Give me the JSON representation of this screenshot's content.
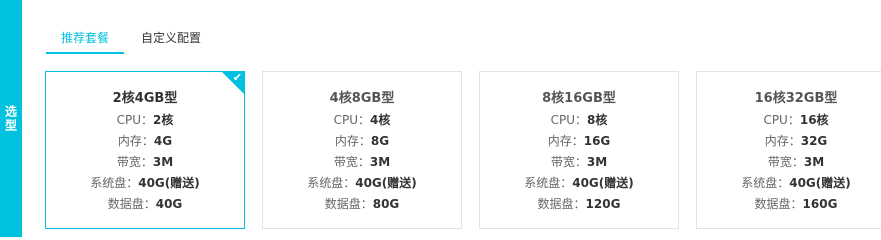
{
  "side_label": "选型",
  "tabs": [
    {
      "label": "推荐套餐",
      "active": true
    },
    {
      "label": "自定义配置",
      "active": false
    }
  ],
  "packages": [
    {
      "title": "2核4GB型",
      "cpu": {
        "label": "CPU：",
        "value": "2核"
      },
      "memory": {
        "label": "内存：",
        "value": "4G"
      },
      "bandwidth": {
        "label": "带宽：",
        "value": "3M"
      },
      "system_disk": {
        "label": "系统盘：",
        "value": "40G(赠送)"
      },
      "data_disk": {
        "label": "数据盘：",
        "value": "40G"
      },
      "selected": true
    },
    {
      "title": "4核8GB型",
      "cpu": {
        "label": "CPU：",
        "value": "4核"
      },
      "memory": {
        "label": "内存：",
        "value": "8G"
      },
      "bandwidth": {
        "label": "带宽：",
        "value": "3M"
      },
      "system_disk": {
        "label": "系统盘：",
        "value": "40G(赠送)"
      },
      "data_disk": {
        "label": "数据盘：",
        "value": "80G"
      },
      "selected": false
    },
    {
      "title": "8核16GB型",
      "cpu": {
        "label": "CPU：",
        "value": "8核"
      },
      "memory": {
        "label": "内存：",
        "value": "16G"
      },
      "bandwidth": {
        "label": "带宽：",
        "value": "3M"
      },
      "system_disk": {
        "label": "系统盘：",
        "value": "40G(赠送)"
      },
      "data_disk": {
        "label": "数据盘：",
        "value": "120G"
      },
      "selected": false
    },
    {
      "title": "16核32GB型",
      "cpu": {
        "label": "CPU：",
        "value": "16核"
      },
      "memory": {
        "label": "内存：",
        "value": "32G"
      },
      "bandwidth": {
        "label": "带宽：",
        "value": "3M"
      },
      "system_disk": {
        "label": "系统盘：",
        "value": "40G(赠送)"
      },
      "data_disk": {
        "label": "数据盘：",
        "value": "160G"
      },
      "selected": false
    }
  ],
  "colors": {
    "accent": "#00c1de",
    "border": "#e3e3e3"
  },
  "icons": {
    "selected": "checkmark-icon"
  }
}
